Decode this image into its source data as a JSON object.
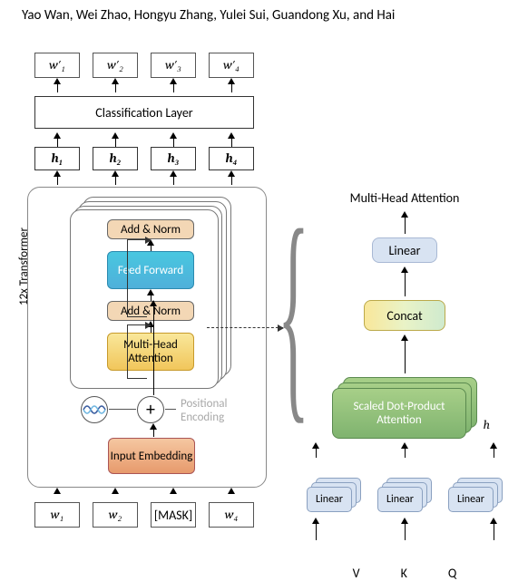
{
  "header": "Yao Wan, Wei Zhao, Hongyu Zhang, Yulei Sui, Guandong Xu, and Hai",
  "outputs": [
    "w′₁",
    "w′₂",
    "w′₃",
    "w′₄"
  ],
  "hidden": [
    "h₁",
    "h₂",
    "h₃",
    "h₄"
  ],
  "inputs": [
    "w₁",
    "w₂",
    "[MASK]",
    "w₄"
  ],
  "classification_label": "Classification  Layer",
  "transformer_label": "12x Transformer",
  "addnorm_label": "Add & Norm",
  "ff_label": "Feed Forward",
  "mha_label": "Multi-Head Attention",
  "pe_label": "Positional Encoding",
  "input_emb_label": "Input Embedding",
  "right_title": "Multi-Head Attention",
  "linear_label": "Linear",
  "concat_label": "Concat",
  "sdpa_label": "Scaled Dot-Product Attention",
  "h_label": "h",
  "vkq": [
    "V",
    "K",
    "Q"
  ],
  "chart_data": {
    "type": "diagram",
    "title": "Transformer encoder with Multi-Head Attention detail",
    "left_module": {
      "inputs": [
        "w1",
        "w2",
        "[MASK]",
        "w4"
      ],
      "embedding": "Input Embedding",
      "positional_encoding": true,
      "layers": 12,
      "block_sequence": [
        "Multi-Head Attention",
        "Add & Norm",
        "Feed Forward",
        "Add & Norm"
      ],
      "residual_connections": true,
      "hidden_outputs": [
        "h1",
        "h2",
        "h3",
        "h4"
      ],
      "head": "Classification Layer",
      "predictions": [
        "w'1",
        "w'2",
        "w'3",
        "w'4"
      ]
    },
    "right_module": {
      "name": "Multi-Head Attention",
      "inputs": [
        "V",
        "K",
        "Q"
      ],
      "per_head": [
        "Linear",
        "Linear",
        "Linear"
      ],
      "core": "Scaled Dot-Product Attention",
      "heads": "h",
      "combine": "Concat",
      "output_projection": "Linear"
    }
  }
}
